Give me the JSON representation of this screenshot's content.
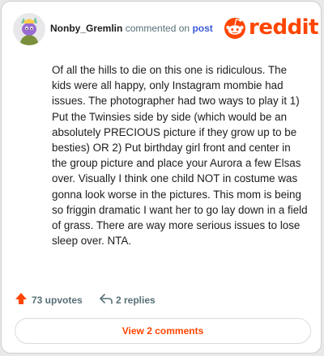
{
  "comment": {
    "username": "Nonby_Gremlin",
    "commented_on": "commented on",
    "post_link": "post",
    "text": "Of all the hills to die on this one is ridiculous. The kids were all happy, only Instagram mombie had issues. The photographer had two ways to play it 1) Put the Twinsies side by side (which would be an absolutely PRECIOUS picture if they grow up to be besties) OR 2) Put birthday girl front and center in the group picture and place your Aurora a few Elsas over. Visually I think one child NOT in costume was gonna look worse in the pictures. This mom is being so friggin dramatic I want her to go lay down in a field of grass. There are way more serious issues to lose sleep over. NTA."
  },
  "brand": {
    "name": "reddit",
    "color": "#ff4500"
  },
  "stats": {
    "upvotes": "73 upvotes",
    "replies": "2 replies"
  },
  "footer": {
    "view_comments": "View 2 comments"
  },
  "icons": {
    "avatar": "snoo-avatar",
    "upvote": "upvote-arrow-icon",
    "reply": "reply-arrow-icon",
    "logo": "reddit-snoo-icon"
  }
}
